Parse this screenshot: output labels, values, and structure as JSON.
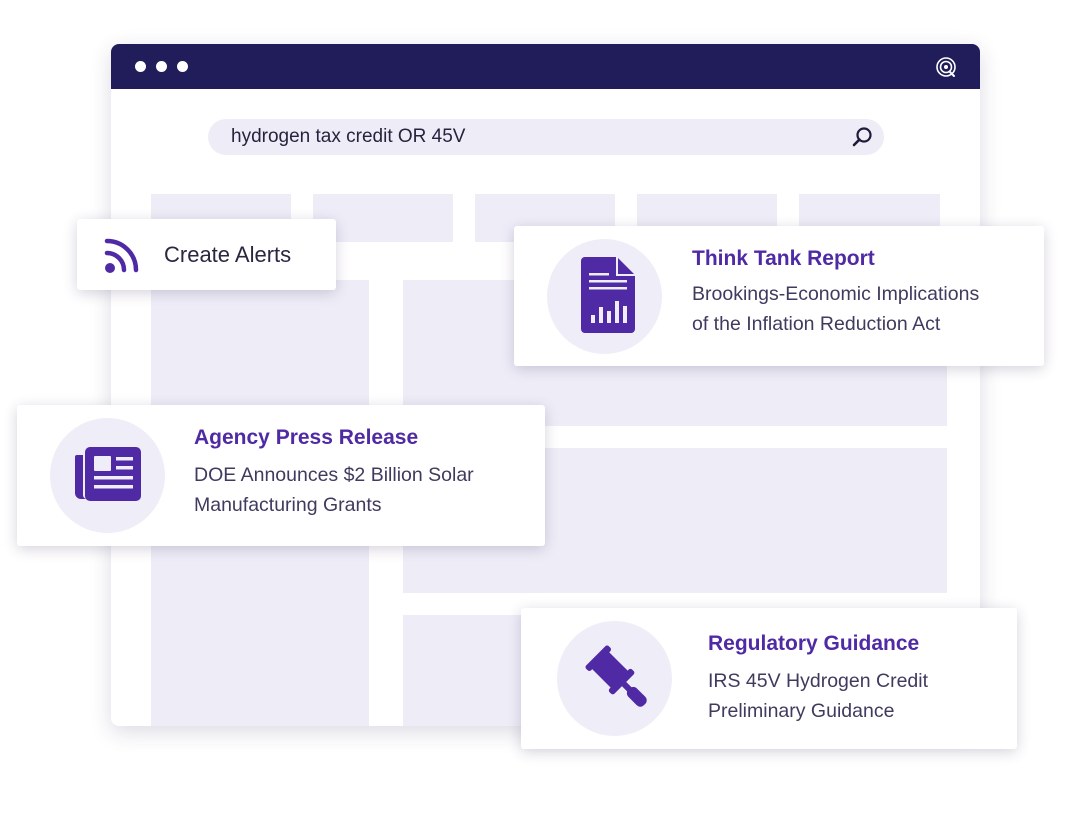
{
  "colors": {
    "titlebar": "#211d5a",
    "accent": "#4f2aa4",
    "placeholder": "#eeedf7"
  },
  "search": {
    "query": "hydrogen tax credit OR 45V",
    "icon": "search-icon"
  },
  "alert": {
    "label": "Create Alerts",
    "icon": "rss-icon"
  },
  "cards": [
    {
      "title": "Think Tank Report",
      "lines": [
        "Brookings-Economic Implications",
        "of the Inflation Reduction Act"
      ],
      "icon": "report-document-icon"
    },
    {
      "title": "Agency Press Release",
      "lines": [
        "DOE Announces $2 Billion Solar",
        "Manufacturing Grants"
      ],
      "icon": "newspaper-icon"
    },
    {
      "title": "Regulatory Guidance",
      "lines": [
        "IRS 45V Hydrogen Credit",
        "Preliminary Guidance"
      ],
      "icon": "gavel-icon"
    }
  ]
}
